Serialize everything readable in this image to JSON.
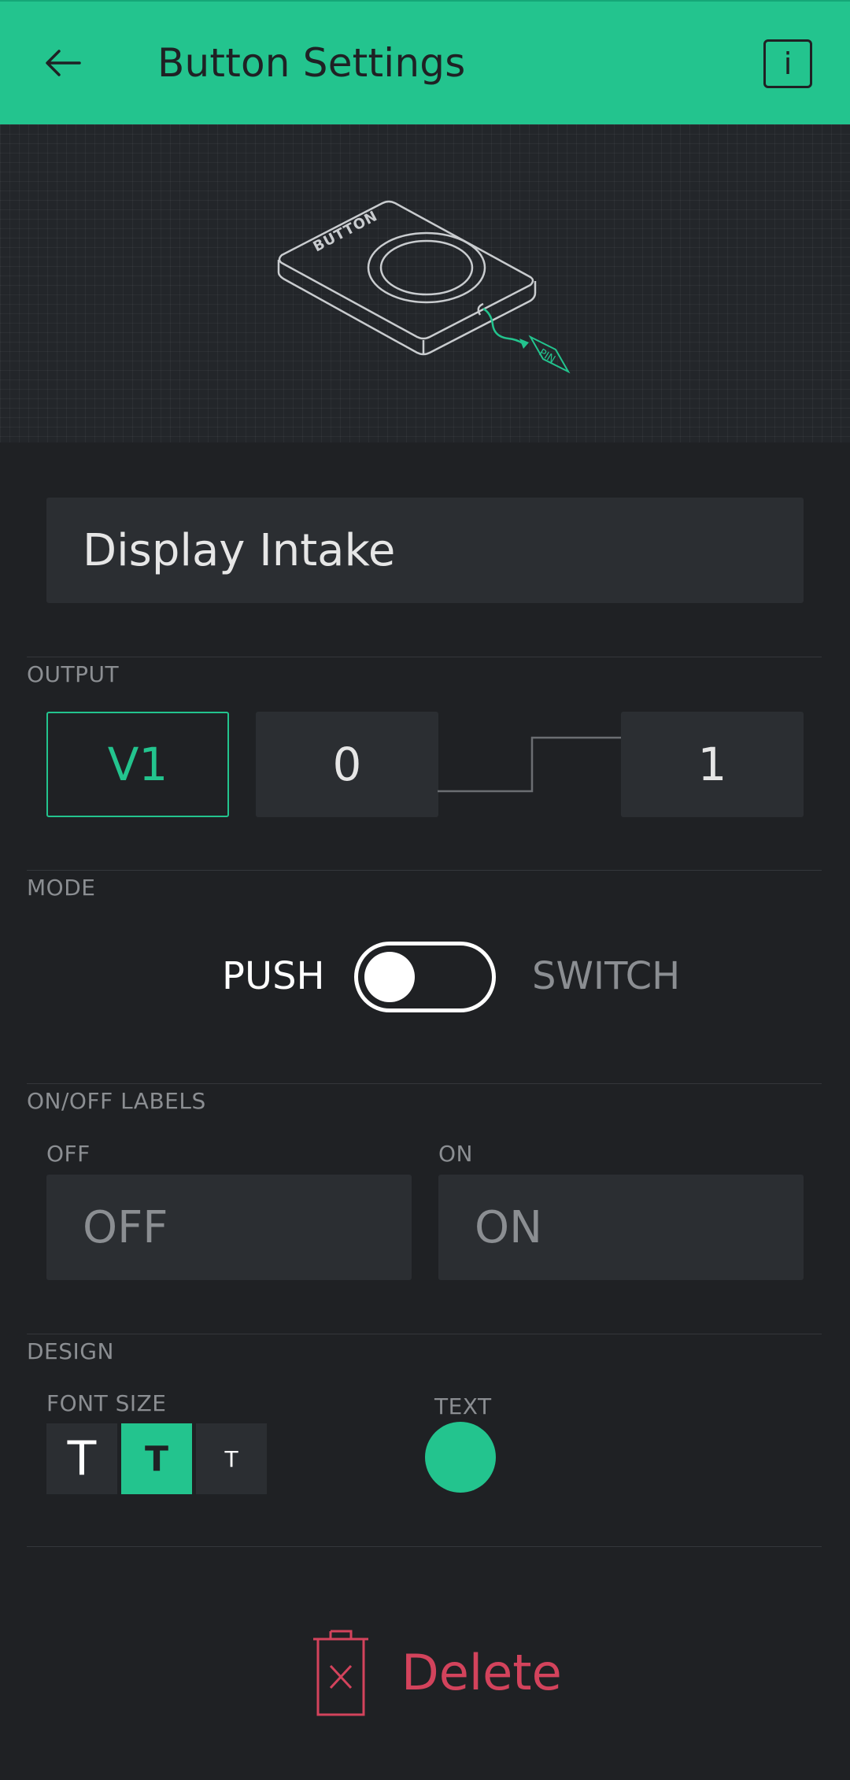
{
  "header": {
    "title": "Button Settings",
    "info_label": "i"
  },
  "illustration": {
    "button_text": "BUTTON",
    "pin_text": "PIN"
  },
  "name_field": {
    "value": "Display Intake"
  },
  "output": {
    "section_label": "OUTPUT",
    "pin": "V1",
    "low_value": "0",
    "high_value": "1"
  },
  "mode": {
    "section_label": "MODE",
    "push_label": "PUSH",
    "switch_label": "SWITCH",
    "selected": "PUSH"
  },
  "labels": {
    "section_label": "ON/OFF LABELS",
    "off_caption": "OFF",
    "on_caption": "ON",
    "off_value": "OFF",
    "on_value": "ON"
  },
  "design": {
    "section_label": "DESIGN",
    "font_size_label": "FONT SIZE",
    "font_sizes": [
      "T",
      "T",
      "T"
    ],
    "selected_font_size_index": 1,
    "text_color_label": "TEXT",
    "text_color": "#23c48e"
  },
  "delete": {
    "label": "Delete"
  },
  "colors": {
    "accent": "#23c48e",
    "danger": "#d3435c",
    "background": "#1f2124"
  }
}
